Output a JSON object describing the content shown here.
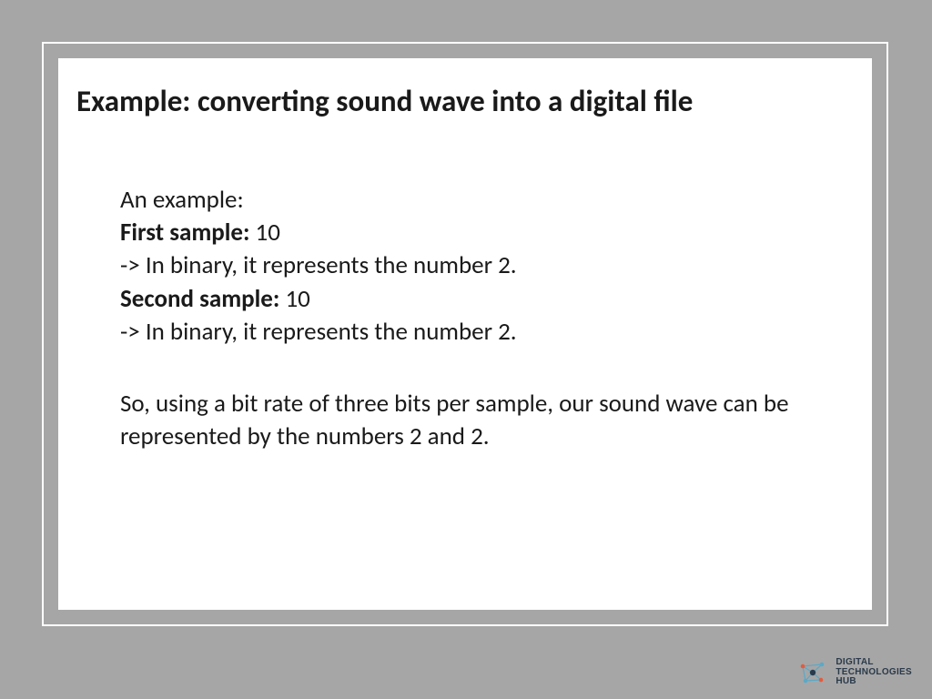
{
  "slide": {
    "title": "Example: converting sound wave into a digital file",
    "intro": "An example:",
    "sample1_label": "First sample:",
    "sample1_value": " 10",
    "sample1_explain": "-> In binary, it represents the number 2.",
    "sample2_label": "Second sample:",
    "sample2_value": " 10",
    "sample2_explain": "-> In binary, it represents the number 2.",
    "conclusion": "So, using a bit rate of three bits per sample, our sound wave can be represented by the numbers 2 and 2."
  },
  "logo": {
    "line1": "DIGITAL",
    "line2": "TECHNOLOGIES",
    "line3": "HUB"
  }
}
